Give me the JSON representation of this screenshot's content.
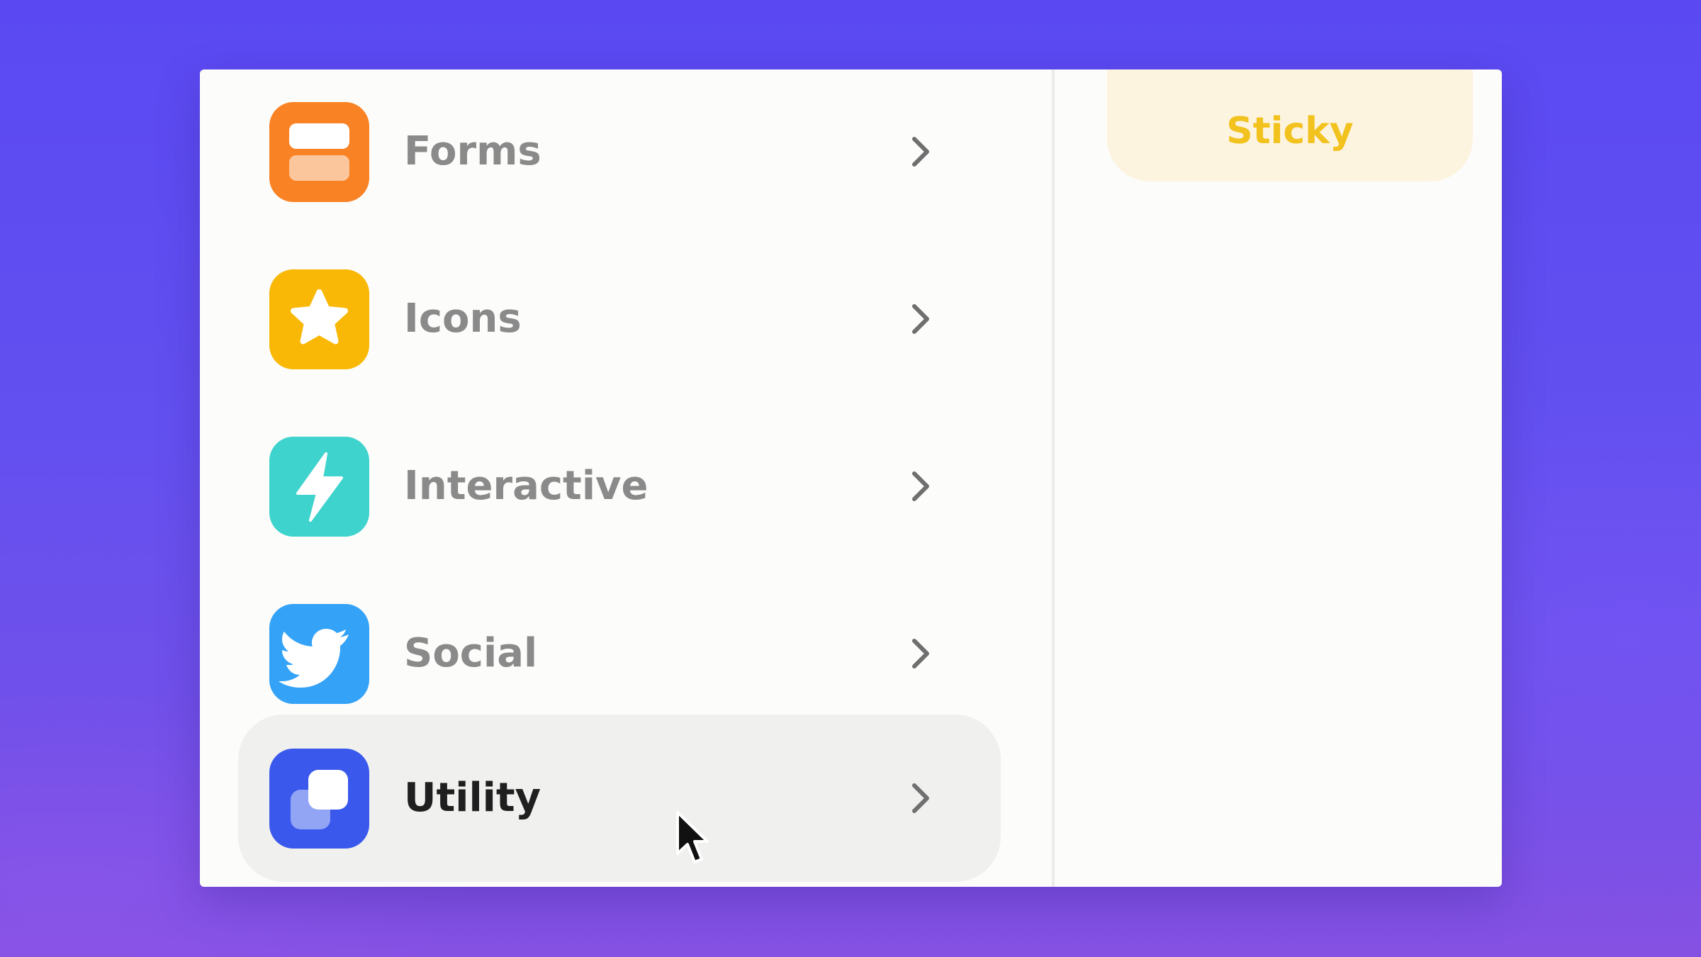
{
  "sidebar": {
    "items": [
      {
        "label": "Forms",
        "icon": "forms-icon",
        "color": "#f98224",
        "active": false
      },
      {
        "label": "Icons",
        "icon": "star-icon",
        "color": "#f9b806",
        "active": false
      },
      {
        "label": "Interactive",
        "icon": "lightning-icon",
        "color": "#3fd3cd",
        "active": false
      },
      {
        "label": "Social",
        "icon": "twitter-bird-icon",
        "color": "#34a3f7",
        "active": false
      },
      {
        "label": "Utility",
        "icon": "layers-icon",
        "color": "#3a59ec",
        "active": true
      }
    ]
  },
  "right_panel": {
    "sticky_card": {
      "label": "Sticky",
      "color": "#f2c21e"
    }
  }
}
